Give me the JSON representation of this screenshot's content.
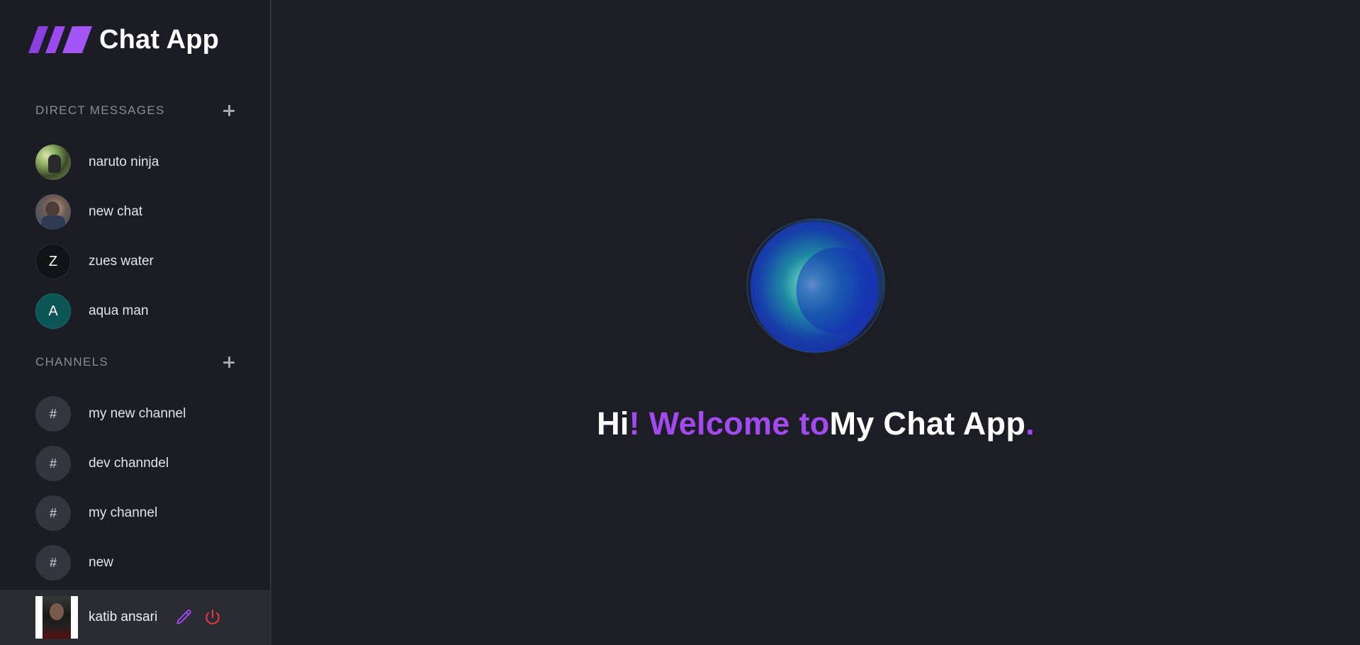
{
  "app": {
    "title": "Chat App",
    "accent_color": "#a349f0"
  },
  "sidebar": {
    "direct_messages": {
      "title": "DIRECT MESSAGES",
      "items": [
        {
          "name": "naruto ninja",
          "avatar": "photo"
        },
        {
          "name": "new chat",
          "avatar": "photo"
        },
        {
          "name": "zues water",
          "avatar": "letter",
          "initial": "Z"
        },
        {
          "name": "aqua man",
          "avatar": "letter",
          "initial": "A"
        }
      ]
    },
    "channels": {
      "title": "CHANNELS",
      "items": [
        {
          "name": "my new channel",
          "symbol": "#"
        },
        {
          "name": "dev channdel",
          "symbol": "#"
        },
        {
          "name": "my channel",
          "symbol": "#"
        },
        {
          "name": "new",
          "symbol": "#"
        }
      ]
    },
    "profile": {
      "name": "katib ansari",
      "edit_icon": "pencil-icon",
      "logout_icon": "power-icon",
      "edit_color": "#a349f0",
      "logout_color": "#e0393e"
    }
  },
  "main": {
    "welcome": {
      "part1": "Hi",
      "part2": "! Welcome to",
      "part3": "My Chat App",
      "part4": "."
    }
  }
}
